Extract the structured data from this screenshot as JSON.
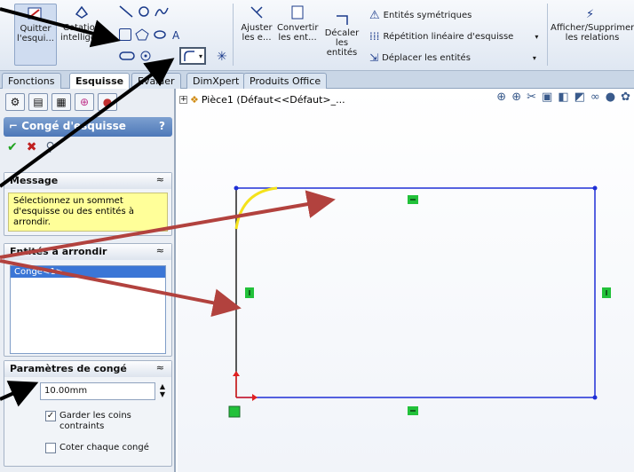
{
  "ribbon": {
    "exit_sketch": "Quitter l'esqui...",
    "smart_dim": "Cotation intelligente",
    "trim": "Ajuster les e...",
    "convert": "Convertir les ent...",
    "offset": "Décaler les entités",
    "mirror": "Entités symétriques",
    "linear_pattern": "Répétition linéaire d'esquisse",
    "move": "Déplacer les entités",
    "relations": "Afficher/Supprimer les relations"
  },
  "tabs": [
    "Fonctions",
    "Esquisse",
    "Evaluer",
    "DimXpert",
    "Produits Office"
  ],
  "tree": {
    "label": "Pièce1  (Défaut<<Défaut>_..."
  },
  "pm": {
    "title": "Congé d'esquisse",
    "help": "?",
    "message_header": "Message",
    "message_text": "Sélectionnez un sommet d'esquisse ou des entités à arrondir.",
    "entities_header": "Entités à arrondir",
    "entities_item": "Congé<1>",
    "params_header": "Paramètres de congé",
    "radius_value": "10.00mm",
    "keep_corners": "Garder les coins contraints",
    "dimension_each": "Coter chaque congé"
  },
  "colors": {
    "sketch_line": "#1f2fd6",
    "fillet_arc": "#f4e21b",
    "arrow": "#b2423e",
    "relation_green": "#22c13a"
  }
}
